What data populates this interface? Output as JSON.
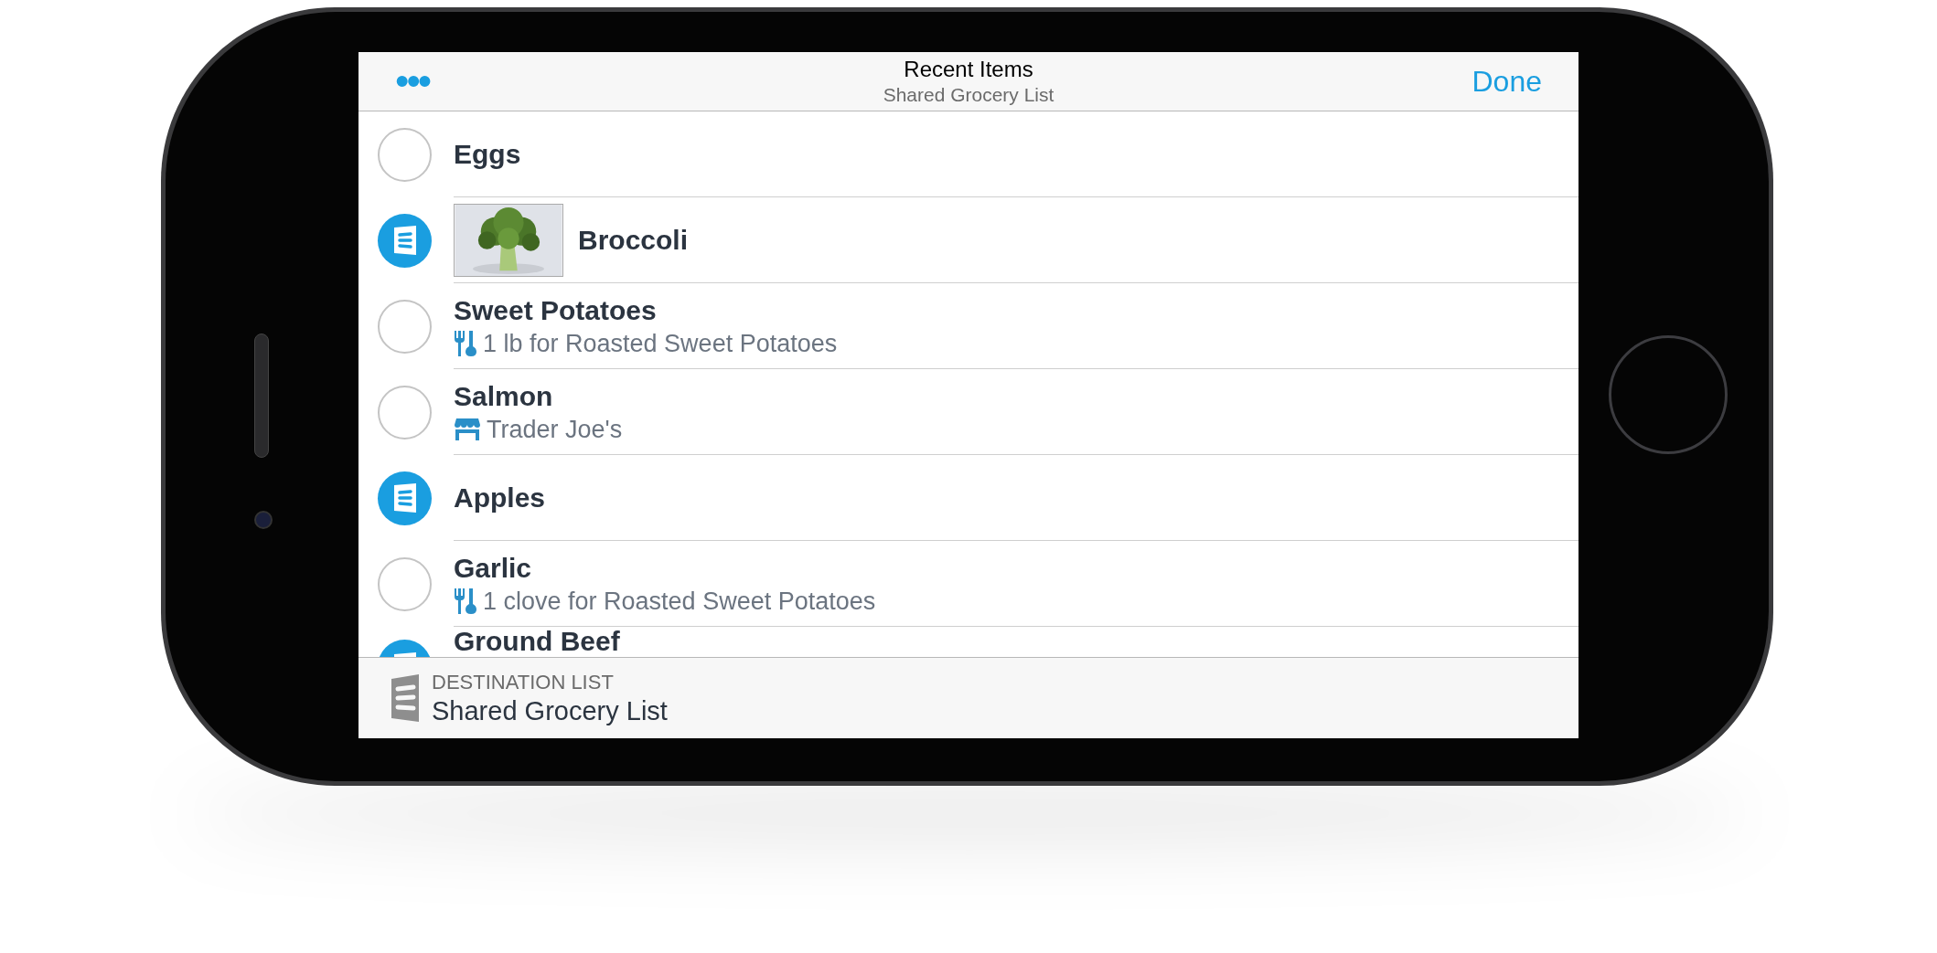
{
  "header": {
    "menu_icon": "•••",
    "title": "Recent Items",
    "subtitle": "Shared Grocery List",
    "done_button": "Done"
  },
  "items": [
    {
      "name": "Eggs",
      "checked": false
    },
    {
      "name": "Broccoli",
      "checked": true
    },
    {
      "name": "Sweet Potatoes",
      "checked": false,
      "detail": {
        "kind": "recipe",
        "text": "1 lb for Roasted Sweet Potatoes"
      }
    },
    {
      "name": "Salmon",
      "checked": false,
      "detail": {
        "kind": "store",
        "text": "Trader Joe's"
      }
    },
    {
      "name": "Apples",
      "checked": true
    },
    {
      "name": "Garlic",
      "checked": false,
      "detail": {
        "kind": "recipe",
        "text": "1 clove for Roasted Sweet Potatoes"
      }
    },
    {
      "name": "Ground Beef",
      "checked": true
    }
  ],
  "footer": {
    "label": "DESTINATION LIST",
    "value": "Shared Grocery List"
  }
}
